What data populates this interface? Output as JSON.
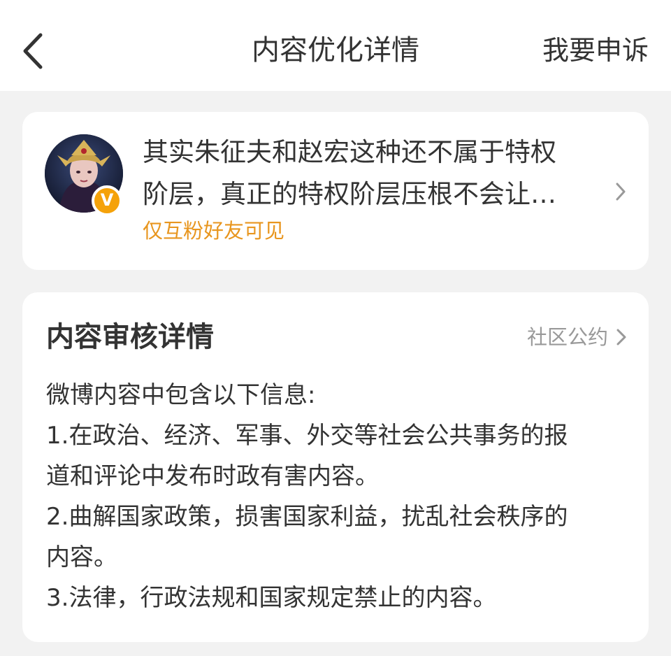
{
  "nav": {
    "title": "内容优化详情",
    "appeal_label": "我要申诉"
  },
  "post": {
    "text_line_1": "其实朱征夫和赵宏这种还不属于特权",
    "text_line_2": "阶层，真正的特权阶层压根不会让…",
    "visibility": "仅互粉好友可见",
    "badge": "V",
    "avatar_icon": "avatar-illustration",
    "badge_icon": "verified-v-icon"
  },
  "detail": {
    "title": "内容审核详情",
    "rules_link": "社区公约",
    "intro": "微博内容中包含以下信息:",
    "lines": [
      "1.在政治、经济、军事、外交等社会公共事务的报",
      "道和评论中发布时政有害内容。",
      "2.曲解国家政策，损害国家利益，扰乱社会秩序的",
      "内容。",
      "3.法律，行政法规和国家规定禁止的内容。"
    ]
  },
  "colors": {
    "accent": "#e8961f",
    "badge": "#f5a20a",
    "background": "#f2f2f2",
    "card": "#ffffff",
    "text": "#333333",
    "muted": "#999999"
  }
}
